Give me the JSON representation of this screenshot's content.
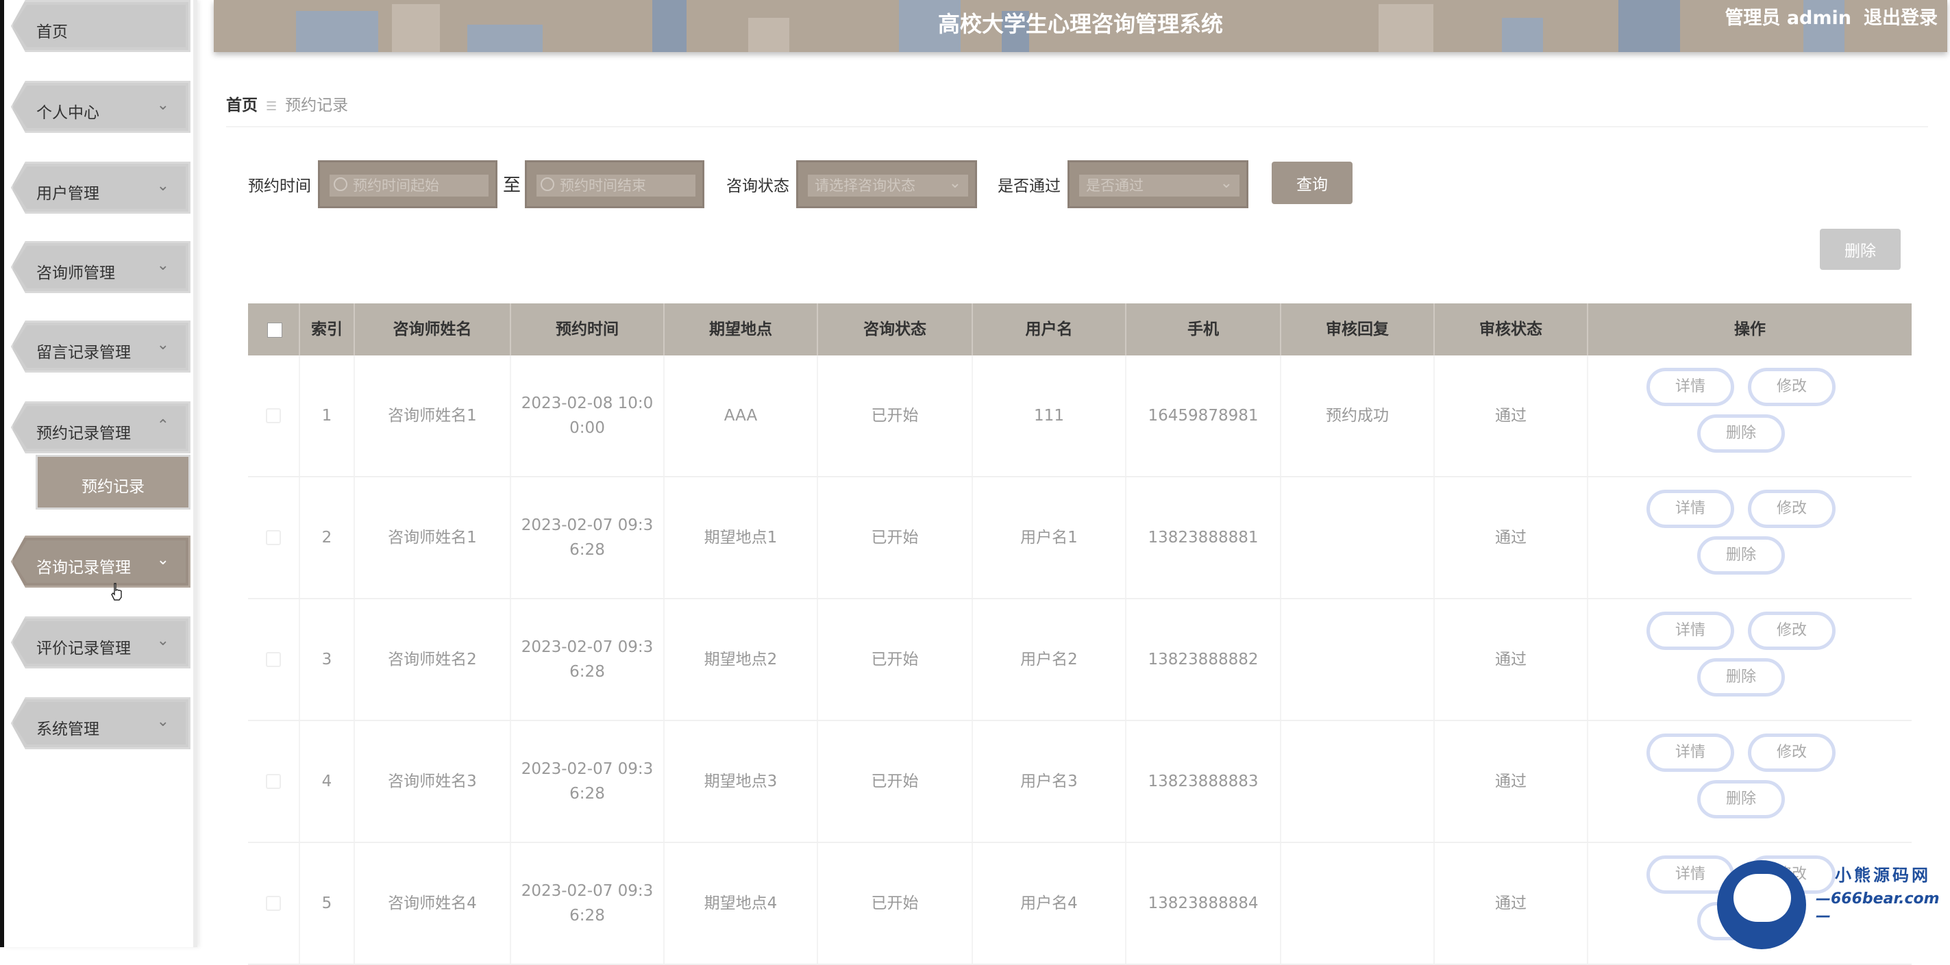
{
  "header": {
    "title": "高校大学生心理咨询管理系统",
    "user": "管理员 admin",
    "logout": "退出登录"
  },
  "sidebar": {
    "items": [
      {
        "label": "首页"
      },
      {
        "label": "个人中心",
        "chevron": "⌄"
      },
      {
        "label": "用户管理",
        "chevron": "⌄"
      },
      {
        "label": "咨询师管理",
        "chevron": "⌄"
      },
      {
        "label": "留言记录管理",
        "chevron": "⌄"
      },
      {
        "label": "预约记录管理",
        "chevron": "⌃"
      },
      {
        "label": "咨询记录管理",
        "chevron": "⌄"
      },
      {
        "label": "评价记录管理",
        "chevron": "⌄"
      },
      {
        "label": "系统管理",
        "chevron": "⌄"
      }
    ],
    "sub_item": "预约记录"
  },
  "breadcrumb": {
    "home": "首页",
    "separator": "☰",
    "current": "预约记录"
  },
  "search": {
    "time_label": "预约时间",
    "time_start_placeholder": "预约时间起始",
    "to": "至",
    "time_end_placeholder": "预约时间结束",
    "status_label": "咨询状态",
    "status_placeholder": "请选择咨询状态",
    "pass_label": "是否通过",
    "pass_placeholder": "是否通过",
    "query_button": "查询",
    "delete_button": "删除"
  },
  "table": {
    "headers": [
      "索引",
      "咨询师姓名",
      "预约时间",
      "期望地点",
      "咨询状态",
      "用户名",
      "手机",
      "审核回复",
      "审核状态",
      "操作"
    ],
    "rows": [
      {
        "index": "1",
        "counselor": "咨询师姓名1",
        "time": "2023-02-08 10:00:00",
        "place": "AAA",
        "status": "已开始",
        "user": "111",
        "phone": "16459878981",
        "reply": "预约成功",
        "audit": "通过"
      },
      {
        "index": "2",
        "counselor": "咨询师姓名1",
        "time": "2023-02-07 09:36:28",
        "place": "期望地点1",
        "status": "已开始",
        "user": "用户名1",
        "phone": "13823888881",
        "reply": "",
        "audit": "通过"
      },
      {
        "index": "3",
        "counselor": "咨询师姓名2",
        "time": "2023-02-07 09:36:28",
        "place": "期望地点2",
        "status": "已开始",
        "user": "用户名2",
        "phone": "13823888882",
        "reply": "",
        "audit": "通过"
      },
      {
        "index": "4",
        "counselor": "咨询师姓名3",
        "time": "2023-02-07 09:36:28",
        "place": "期望地点3",
        "status": "已开始",
        "user": "用户名3",
        "phone": "13823888883",
        "reply": "",
        "audit": "通过"
      },
      {
        "index": "5",
        "counselor": "咨询师姓名4",
        "time": "2023-02-07 09:36:28",
        "place": "期望地点4",
        "status": "已开始",
        "user": "用户名4",
        "phone": "13823888884",
        "reply": "",
        "audit": "通过"
      }
    ],
    "actions": {
      "detail": "详情",
      "edit": "修改",
      "delete": "删除"
    }
  },
  "watermark": {
    "name": "小熊源码网",
    "url": "—666bear.com—"
  },
  "colors": {
    "accent": "#a1968b",
    "header_bg": "#b2a698",
    "table_header": "#bab4ab",
    "action_border": "#d4dcf3"
  }
}
